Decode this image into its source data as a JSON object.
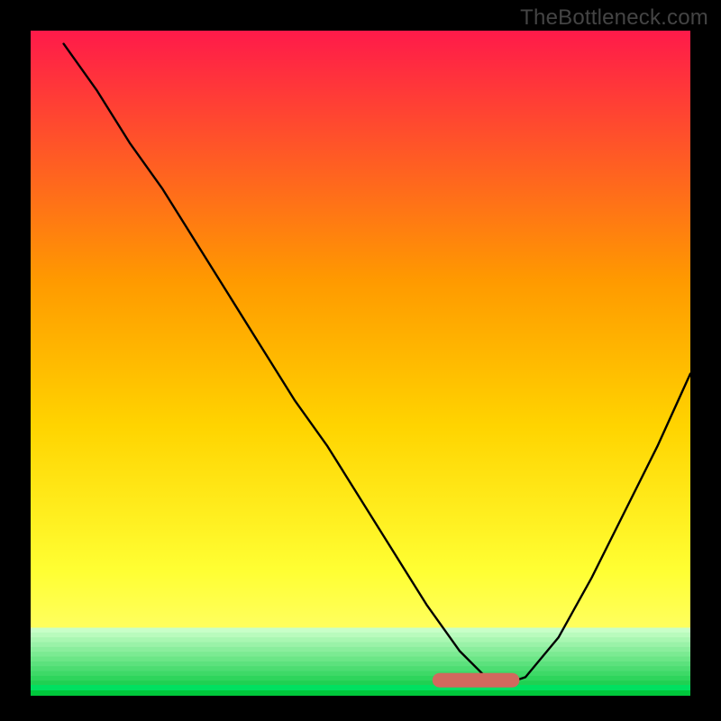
{
  "watermark": "TheBottleneck.com",
  "colors": {
    "border": "#000000",
    "curve": "#000000",
    "valley_fill": "#d1695e",
    "grad_top": "#ff1a4a",
    "grad_mid": "#ffd400",
    "grad_low": "#ffff66",
    "grad_green1": "#7cff7c",
    "grad_green2": "#00e060"
  },
  "chart_data": {
    "type": "line",
    "title": "",
    "xlabel": "",
    "ylabel": "",
    "xlim": [
      0,
      100
    ],
    "ylim": [
      0,
      100
    ],
    "series": [
      {
        "name": "bottleneck-curve",
        "x": [
          5,
          10,
          15,
          20,
          25,
          30,
          35,
          40,
          45,
          50,
          55,
          60,
          65,
          70,
          72,
          75,
          80,
          85,
          90,
          95,
          100
        ],
        "values": [
          98,
          91,
          83,
          76,
          68,
          60,
          52,
          44,
          37,
          29,
          21,
          13,
          6,
          1,
          1,
          2,
          8,
          17,
          27,
          37,
          48
        ]
      }
    ],
    "valley": {
      "x_start": 62,
      "x_end": 73,
      "value": 1
    },
    "background": "vertical gradient: red (top) → orange → yellow → pale-yellow → green bands (bottom) inside a black frame"
  }
}
